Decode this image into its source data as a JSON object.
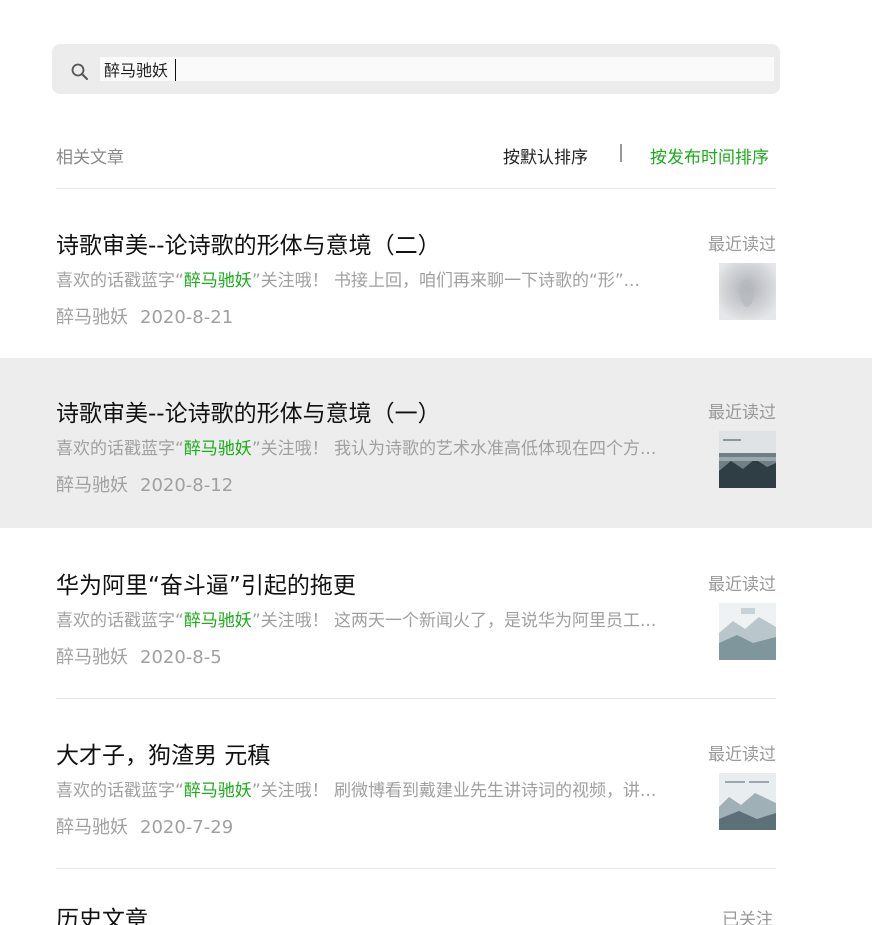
{
  "search": {
    "value": "醉马驰妖",
    "icon": "search-icon"
  },
  "section": {
    "label": "相关文章",
    "sort_default": "按默认排序",
    "sort_time": "按发布时间排序",
    "active_sort_color": "#1aad19"
  },
  "articles": [
    {
      "title": "诗歌审美--论诗歌的形体与意境（二）",
      "read_status": "最近读过",
      "desc_prefix": "喜欢的话戳蓝字“",
      "desc_highlight": "醉马驰妖",
      "desc_suffix": "”关注哦！  书接上回，咱们再来聊一下诗歌的“形”...",
      "author": "醉马驰妖",
      "date": "2020-8-21"
    },
    {
      "title": "诗歌审美--论诗歌的形体与意境（一）",
      "read_status": "最近读过",
      "desc_prefix": "喜欢的话戳蓝字“",
      "desc_highlight": "醉马驰妖",
      "desc_suffix": "”关注哦！  我认为诗歌的艺术水准高低体现在四个方...",
      "author": "醉马驰妖",
      "date": "2020-8-12"
    },
    {
      "title": "华为阿里“奋斗逼”引起的拖更",
      "read_status": "最近读过",
      "desc_prefix": "喜欢的话戳蓝字“",
      "desc_highlight": "醉马驰妖",
      "desc_suffix": "”关注哦！  这两天一个新闻火了，是说华为阿里员工...",
      "author": "醉马驰妖",
      "date": "2020-8-5"
    },
    {
      "title": "大才子，狗渣男 元稹",
      "read_status": "最近读过",
      "desc_prefix": "喜欢的话戳蓝字“",
      "desc_highlight": "醉马驰妖",
      "desc_suffix": "”关注哦！  刷微博看到戴建业先生讲诗词的视频，讲...",
      "author": "醉马驰妖",
      "date": "2020-7-29"
    }
  ],
  "history": {
    "label": "历史文章",
    "follow_status": "已关注"
  }
}
